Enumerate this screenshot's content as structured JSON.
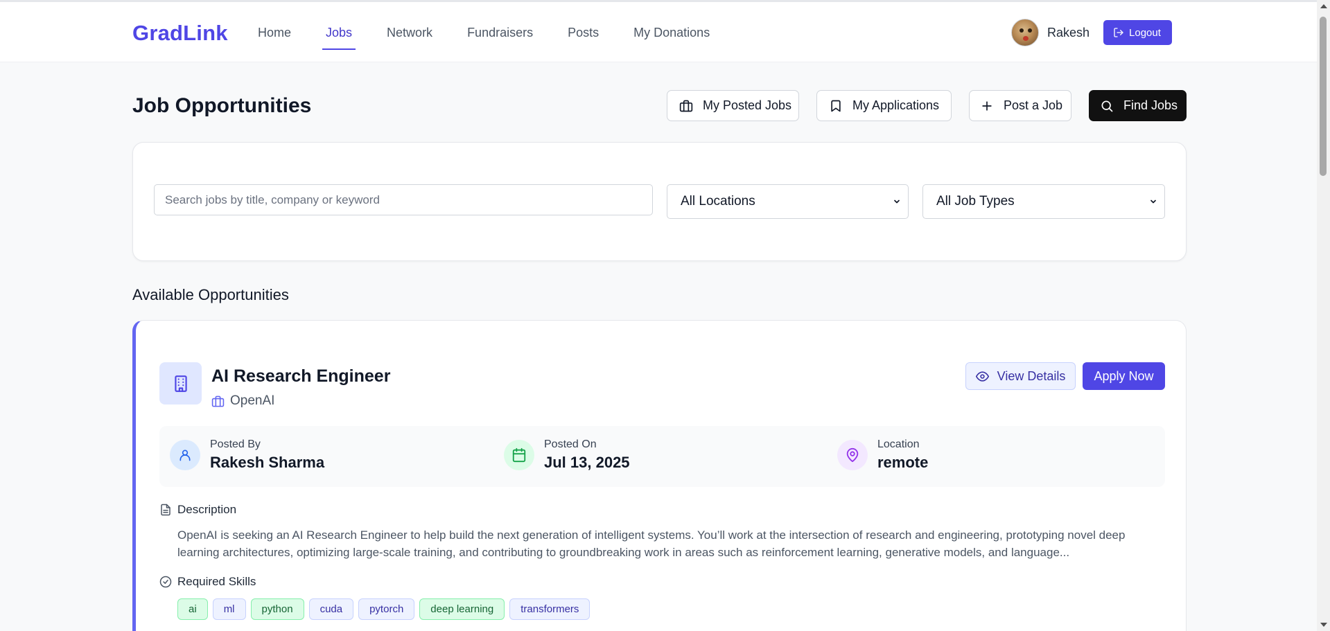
{
  "brand": "GradLink",
  "nav": {
    "links": [
      "Home",
      "Jobs",
      "Network",
      "Fundraisers",
      "Posts",
      "My Donations"
    ],
    "active": "Jobs"
  },
  "user": {
    "name": "Rakesh",
    "logout_label": "Logout"
  },
  "page": {
    "title": "Job Opportunities",
    "buttons": {
      "my_posted_jobs": "My Posted Jobs",
      "my_applications": "My Applications",
      "post_job": "Post a Job",
      "find_jobs": "Find Jobs"
    }
  },
  "filters": {
    "search_placeholder": "Search jobs by title, company or keyword",
    "location_selected": "All Locations",
    "type_selected": "All Job Types"
  },
  "section_title": "Available Opportunities",
  "job": {
    "title": "AI Research Engineer",
    "company": "OpenAI",
    "view_details_label": "View Details",
    "apply_label": "Apply Now",
    "posted_by_label": "Posted By",
    "posted_by": "Rakesh Sharma",
    "posted_on_label": "Posted On",
    "posted_on": "Jul 13, 2025",
    "location_label": "Location",
    "location": "remote",
    "description_label": "Description",
    "description": "OpenAI is seeking an AI Research Engineer to help build the next generation of intelligent systems. You’ll work at the intersection of research and engineering, prototyping novel deep learning architectures, optimizing large-scale training, and contributing to groundbreaking work in areas such as reinforcement learning, generative models, and language...",
    "skills_label": "Required Skills",
    "skills": [
      "ai",
      "ml",
      "python",
      "cuda",
      "pytorch",
      "deep learning",
      "transformers"
    ]
  },
  "colors": {
    "brand": "#4f46e5",
    "skill_green": "#dcfce7",
    "skill_indigo": "#eef2ff",
    "card_accent": "#6366f1"
  }
}
